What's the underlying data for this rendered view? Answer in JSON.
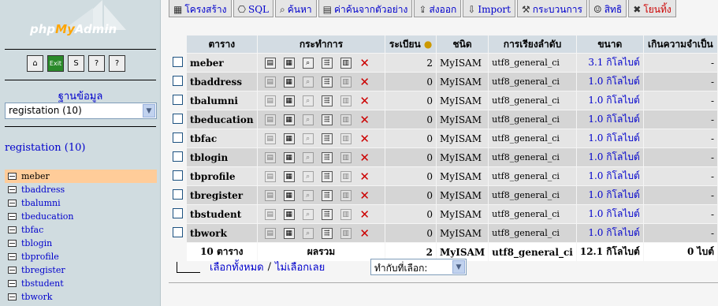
{
  "sidebar": {
    "logo_prefix": "php",
    "logo_mid": "My",
    "logo_suffix": "Admin",
    "quick_icons": [
      "home-icon",
      "exit-icon",
      "sql-icon",
      "help-icon",
      "docs-icon"
    ],
    "db_label": "ฐานข้อมูล",
    "db_select": "registation (10)",
    "db_title": "registation (10)",
    "tables": [
      "meber",
      "tbaddress",
      "tbalumni",
      "tbeducation",
      "tbfac",
      "tblogin",
      "tbprofile",
      "tbregister",
      "tbstudent",
      "tbwork"
    ]
  },
  "tabs": [
    {
      "label": "โครงสร้าง",
      "icon": "structure-icon"
    },
    {
      "label": "SQL",
      "icon": "sql-icon"
    },
    {
      "label": "ค้นหา",
      "icon": "search-icon"
    },
    {
      "label": "ค่าค้นจากตัวอย่าง",
      "icon": "query-icon"
    },
    {
      "label": "ส่งออก",
      "icon": "export-icon"
    },
    {
      "label": "Import",
      "icon": "import-icon"
    },
    {
      "label": "กระบวนการ",
      "icon": "operations-icon"
    },
    {
      "label": "สิทธิ",
      "icon": "privileges-icon"
    },
    {
      "label": "โยนทิ้ง",
      "icon": "drop-icon"
    }
  ],
  "table": {
    "headers": {
      "name": "ตาราง",
      "action": "กระทำการ",
      "rows": "ระเบียน",
      "type": "ชนิด",
      "collation": "การเรียงลำดับ",
      "size": "ขนาด",
      "overhead": "เกินความจำเป็น"
    },
    "rows": [
      {
        "name": "meber",
        "rows": "2",
        "type": "MyISAM",
        "collation": "utf8_general_ci",
        "size": "3.1 กิโลไบต์",
        "overhead": "-"
      },
      {
        "name": "tbaddress",
        "rows": "0",
        "type": "MyISAM",
        "collation": "utf8_general_ci",
        "size": "1.0 กิโลไบต์",
        "overhead": "-"
      },
      {
        "name": "tbalumni",
        "rows": "0",
        "type": "MyISAM",
        "collation": "utf8_general_ci",
        "size": "1.0 กิโลไบต์",
        "overhead": "-"
      },
      {
        "name": "tbeducation",
        "rows": "0",
        "type": "MyISAM",
        "collation": "utf8_general_ci",
        "size": "1.0 กิโลไบต์",
        "overhead": "-"
      },
      {
        "name": "tbfac",
        "rows": "0",
        "type": "MyISAM",
        "collation": "utf8_general_ci",
        "size": "1.0 กิโลไบต์",
        "overhead": "-"
      },
      {
        "name": "tblogin",
        "rows": "0",
        "type": "MyISAM",
        "collation": "utf8_general_ci",
        "size": "1.0 กิโลไบต์",
        "overhead": "-"
      },
      {
        "name": "tbprofile",
        "rows": "0",
        "type": "MyISAM",
        "collation": "utf8_general_ci",
        "size": "1.0 กิโลไบต์",
        "overhead": "-"
      },
      {
        "name": "tbregister",
        "rows": "0",
        "type": "MyISAM",
        "collation": "utf8_general_ci",
        "size": "1.0 กิโลไบต์",
        "overhead": "-"
      },
      {
        "name": "tbstudent",
        "rows": "0",
        "type": "MyISAM",
        "collation": "utf8_general_ci",
        "size": "1.0 กิโลไบต์",
        "overhead": "-"
      },
      {
        "name": "tbwork",
        "rows": "0",
        "type": "MyISAM",
        "collation": "utf8_general_ci",
        "size": "1.0 กิโลไบต์",
        "overhead": "-"
      }
    ],
    "summary": {
      "count": "10 ตาราง",
      "label": "ผลรวม",
      "rows": "2",
      "type": "MyISAM",
      "collation": "utf8_general_ci",
      "size": "12.1 กิโลไบต์",
      "overhead": "0 ไบต์"
    }
  },
  "bottom": {
    "check_all": "เลือกทั้งหมด",
    "slash": "/",
    "uncheck_all": "ไม่เลือกเลย",
    "with_selected": "ทำกับที่เลือก:"
  },
  "colors": {
    "sidebar": "#d0dce0",
    "header": "#d3dce3",
    "odd": "#e5e5e5",
    "even": "#d5d5d5",
    "link": "#0000cc",
    "active": "#ffcc99"
  }
}
